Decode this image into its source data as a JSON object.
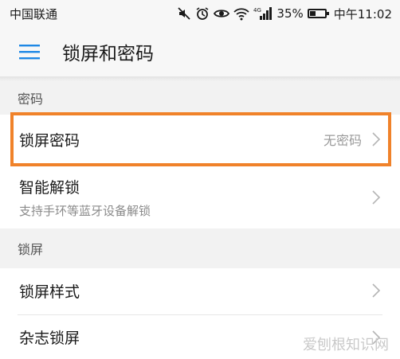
{
  "status_bar": {
    "carrier": "中国联通",
    "battery_percent": "35%",
    "battery_level": 0.35,
    "time": "中午11:02",
    "network_label": "4G",
    "icons": [
      "mute-icon",
      "alarm-icon",
      "eye-icon",
      "wifi-icon",
      "signal-icon",
      "battery-icon"
    ]
  },
  "app_bar": {
    "title": "锁屏和密码",
    "menu_icon": "hamburger-menu-icon"
  },
  "sections": [
    {
      "header": "密码",
      "items": [
        {
          "title": "锁屏密码",
          "value": "无密码"
        },
        {
          "title": "智能解锁",
          "subtitle": "支持手环等蓝牙设备解锁"
        }
      ]
    },
    {
      "header": "锁屏",
      "items": [
        {
          "title": "锁屏样式"
        },
        {
          "title": "杂志锁屏"
        }
      ]
    }
  ],
  "highlight_color": "#f0822a",
  "accent_color": "#1e88e5",
  "watermark": "爱刨根知识网"
}
